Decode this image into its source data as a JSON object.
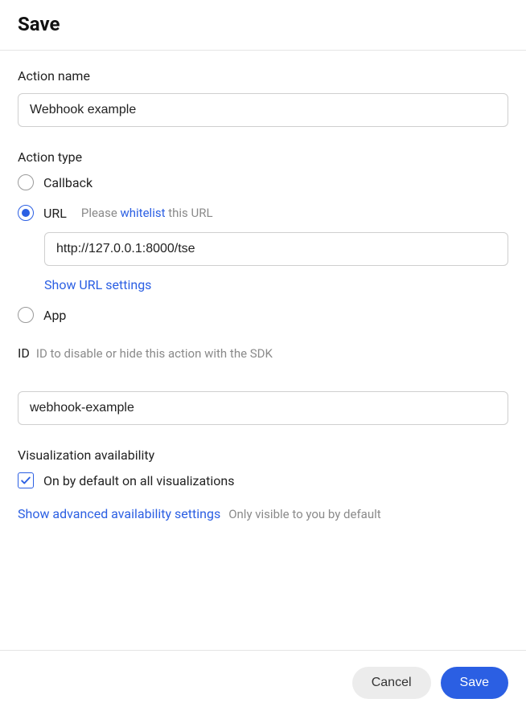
{
  "header": {
    "title": "Save"
  },
  "action_name": {
    "label": "Action name",
    "value": "Webhook example"
  },
  "action_type": {
    "label": "Action type",
    "options": {
      "callback": {
        "label": "Callback",
        "selected": false
      },
      "url": {
        "label": "URL",
        "selected": true,
        "hint_prefix": "Please ",
        "hint_link": "whitelist",
        "hint_suffix": " this URL",
        "url_value": "http://127.0.0.1:8000/tse",
        "show_settings": "Show URL settings"
      },
      "app": {
        "label": "App",
        "selected": false
      }
    }
  },
  "id_field": {
    "label": "ID",
    "hint": "ID to disable or hide this action with the SDK",
    "value": "webhook-example"
  },
  "visualization": {
    "label": "Visualization availability",
    "checkbox_label": "On by default on all visualizations",
    "checked": true,
    "advanced_link": "Show advanced availability settings",
    "advanced_hint": "Only visible to you by default"
  },
  "footer": {
    "cancel": "Cancel",
    "save": "Save"
  }
}
